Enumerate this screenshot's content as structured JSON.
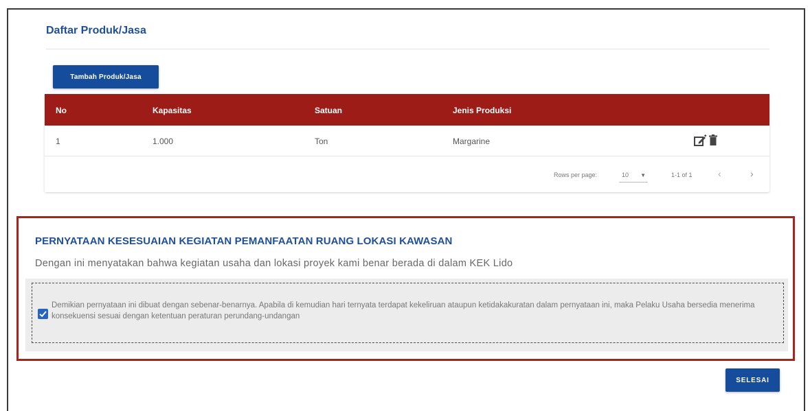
{
  "products": {
    "title": "Daftar Produk/Jasa",
    "add_button": "Tambah Produk/Jasa",
    "columns": [
      "No",
      "Kapasitas",
      "Satuan",
      "Jenis Produksi"
    ],
    "rows": [
      {
        "no": "1",
        "kapasitas": "1.000",
        "satuan": "Ton",
        "jenis": "Margarine"
      }
    ],
    "actions": {
      "edit_icon": "edit-icon",
      "delete_icon": "trash-icon"
    },
    "pagination": {
      "rows_per_page_label": "Rows per page:",
      "rows_per_page_value": "10",
      "range": "1-1 of 1"
    }
  },
  "statement": {
    "title": "PERNYATAAN KESESUAIAN KEGIATAN PEMANFAATAN RUANG LOKASI KAWASAN",
    "description": "Dengan ini menyatakan bahwa kegiatan usaha dan lokasi proyek kami benar berada di dalam KEK Lido",
    "agreement_text": "Demikian pernyataan ini dibuat dengan sebenar-benarnya. Apabila di kemudian hari ternyata terdapat kekeliruan ataupun ketidakakuratan dalam pernyataan ini, maka Pelaku Usaha bersedia menerima konsekuensi sesuai dengan ketentuan peraturan perundang-undangan",
    "agreement_checked": true
  },
  "finish_button": "SELESAI",
  "colors": {
    "brand_blue": "#164c9c",
    "table_header": "#9d1c17",
    "highlight_border": "#a3261e",
    "checkbox": "#2763c2"
  }
}
